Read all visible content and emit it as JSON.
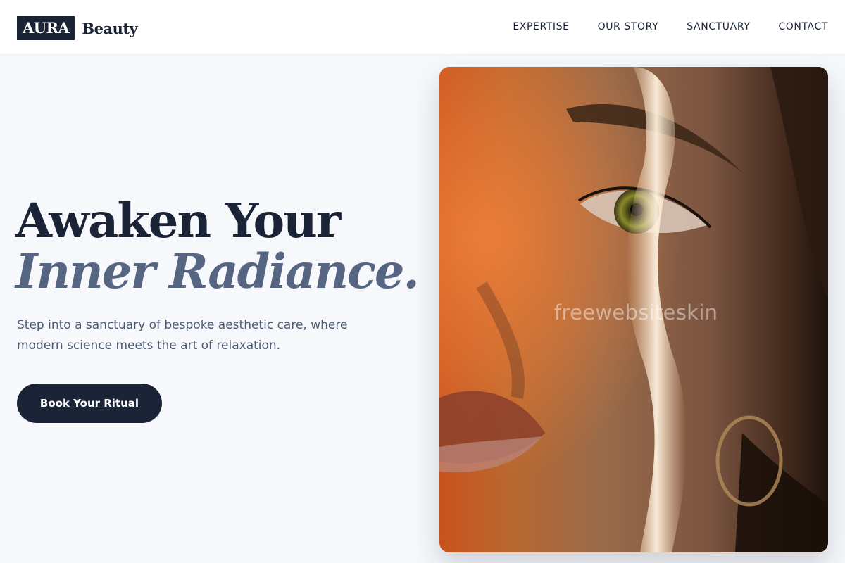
{
  "brand": {
    "logo_box": "AURA",
    "logo_text": "Beauty"
  },
  "nav": {
    "items": [
      {
        "label": "EXPERTISE"
      },
      {
        "label": "OUR STORY"
      },
      {
        "label": "SANCTUARY"
      },
      {
        "label": "CONTACT"
      }
    ]
  },
  "hero": {
    "title_line1": "Awaken Your",
    "title_line2": "Inner Radiance.",
    "subtitle": "Step into a sanctuary of bespoke aesthetic care, where modern science meets the art of relaxation.",
    "cta_label": "Book Your Ritual",
    "watermark": "freewebsiteskin"
  },
  "colors": {
    "primary": "#1b2436",
    "accent": "#566682",
    "background": "#f6f8fc"
  }
}
